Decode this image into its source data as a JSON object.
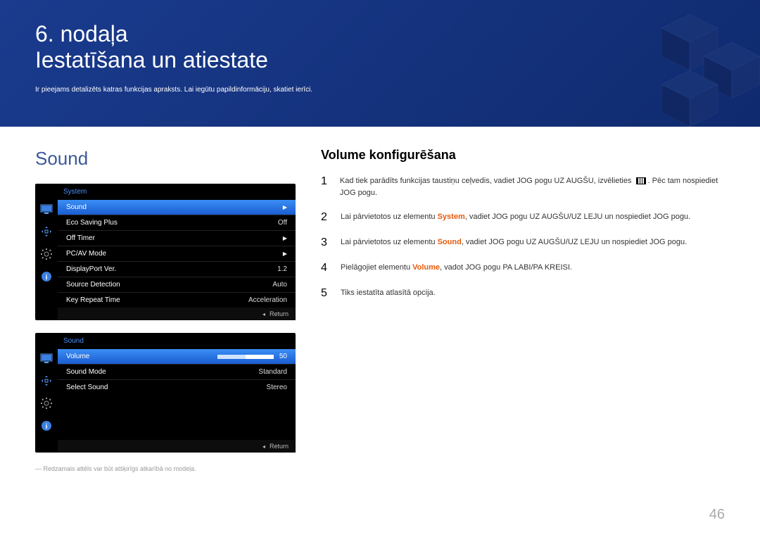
{
  "header": {
    "chapter_num": "6. nodaļa",
    "title": "Iestatīšana un atiestate",
    "subtitle": "Ir pieejams detalizēts katras funkcijas apraksts. Lai iegūtu papildinformāciju, skatiet ierīci."
  },
  "section_title": "Sound",
  "osd1": {
    "title": "System",
    "rows": [
      {
        "label": "Sound",
        "value": "",
        "arrow": "▶",
        "selected": true
      },
      {
        "label": "Eco Saving Plus",
        "value": "Off",
        "arrow": ""
      },
      {
        "label": "Off Timer",
        "value": "",
        "arrow": "▶"
      },
      {
        "label": "PC/AV Mode",
        "value": "",
        "arrow": "▶"
      },
      {
        "label": "DisplayPort Ver.",
        "value": "1.2",
        "arrow": ""
      },
      {
        "label": "Source Detection",
        "value": "Auto",
        "arrow": ""
      },
      {
        "label": "Key Repeat Time",
        "value": "Acceleration",
        "arrow": ""
      }
    ],
    "return": "Return"
  },
  "osd2": {
    "title": "Sound",
    "rows": [
      {
        "label": "Volume",
        "value": "50",
        "progress": 50,
        "selected": true
      },
      {
        "label": "Sound Mode",
        "value": "Standard"
      },
      {
        "label": "Select Sound",
        "value": "Stereo"
      }
    ],
    "return": "Return"
  },
  "footnote": "― Redzamais attēls var būt atšķirīgs atkarībā no modeļa.",
  "right": {
    "heading": "Volume konfigurēšana",
    "steps": [
      {
        "n": "1",
        "pre": "Kad tiek parādīts funkcijas taustiņu ceļvedis, vadiet JOG pogu UZ AUGŠU, izvēlieties ",
        "icon": true,
        "post": ". Pēc tam nospiediet JOG pogu."
      },
      {
        "n": "2",
        "pre": "Lai pārvietotos uz elementu ",
        "kw": "System",
        "post": ", vadiet JOG pogu UZ AUGŠU/UZ LEJU un nospiediet JOG pogu."
      },
      {
        "n": "3",
        "pre": "Lai pārvietotos uz elementu ",
        "kw": "Sound",
        "post": ", vadiet JOG pogu UZ AUGŠU/UZ LEJU un nospiediet JOG pogu."
      },
      {
        "n": "4",
        "pre": "Pielāgojiet elementu ",
        "kw": "Volume",
        "post": ", vadot JOG pogu PA LABI/PA KREISI."
      },
      {
        "n": "5",
        "pre": "Tiks iestatīta atlasītā opcija."
      }
    ]
  },
  "page_number": "46"
}
